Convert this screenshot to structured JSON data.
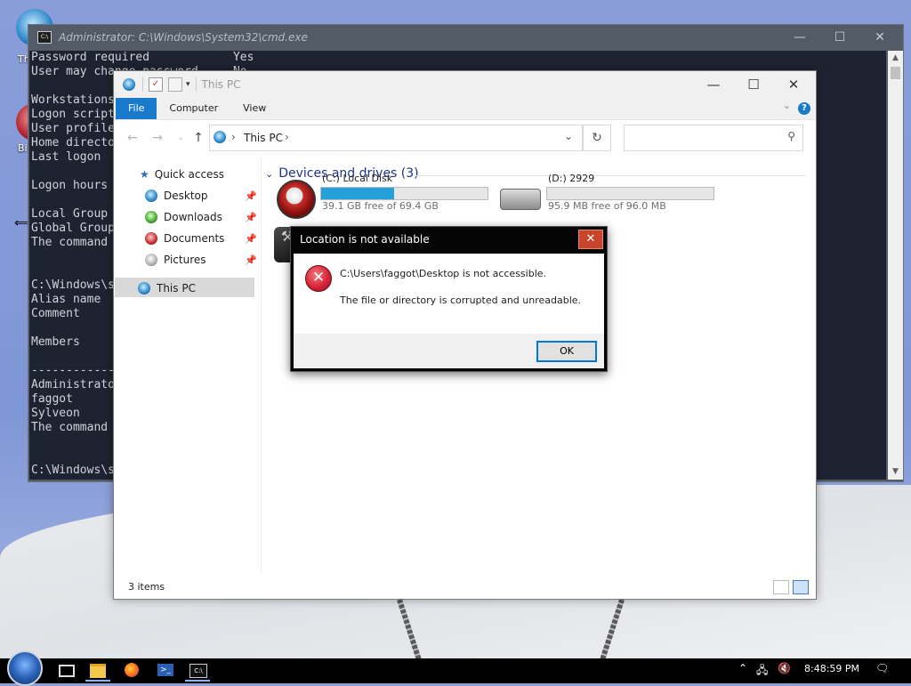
{
  "desktop": {
    "icons": [
      {
        "label": "Th"
      },
      {
        "label": "Bi"
      }
    ]
  },
  "cmd": {
    "title": "Administrator: C:\\Windows\\System32\\cmd.exe",
    "icon_text": "C:\\",
    "lines": [
      "Password required            Yes",
      "User may change password     No",
      "",
      "Workstations",
      "Logon script",
      "User profile",
      "Home director",
      "Last logon",
      "",
      "Logon hours",
      "",
      "Local Group",
      "Global Group",
      "The command",
      "",
      "",
      "C:\\Windows\\s",
      "Alias name",
      "Comment",
      "",
      "Members",
      "",
      "------------",
      "Administrato",
      "faggot",
      "Sylveon",
      "The command",
      "",
      "",
      "C:\\Windows\\s"
    ]
  },
  "explorer": {
    "title": "This PC",
    "tabs": [
      "File",
      "Computer",
      "View"
    ],
    "address_path": [
      "This PC"
    ],
    "nav": {
      "quick_access": "Quick access",
      "items": [
        "Desktop",
        "Downloads",
        "Documents",
        "Pictures"
      ],
      "this_pc": "This PC"
    },
    "group_header": "Devices and drives (3)",
    "drives": [
      {
        "name": "(C:) Local Disk",
        "free_text": "39.1 GB free of 69.4 GB",
        "used_fraction": 0.44
      },
      {
        "name": "(D:) 2929",
        "free_text": "95.9 MB free of 96.0 MB",
        "used_fraction": 0.0
      }
    ],
    "status": "3 items"
  },
  "dialog": {
    "title": "Location is not available",
    "message_1": "C:\\Users\\faggot\\Desktop is not accessible.",
    "message_2": "The file or directory is corrupted and unreadable.",
    "ok_label": "OK",
    "icon": "error-icon"
  },
  "taskbar": {
    "clock": "8:48:59 PM"
  },
  "colors": {
    "accent": "#1979ca",
    "drive_fill": "#26a0da",
    "dialog_close": "#c9442d"
  }
}
